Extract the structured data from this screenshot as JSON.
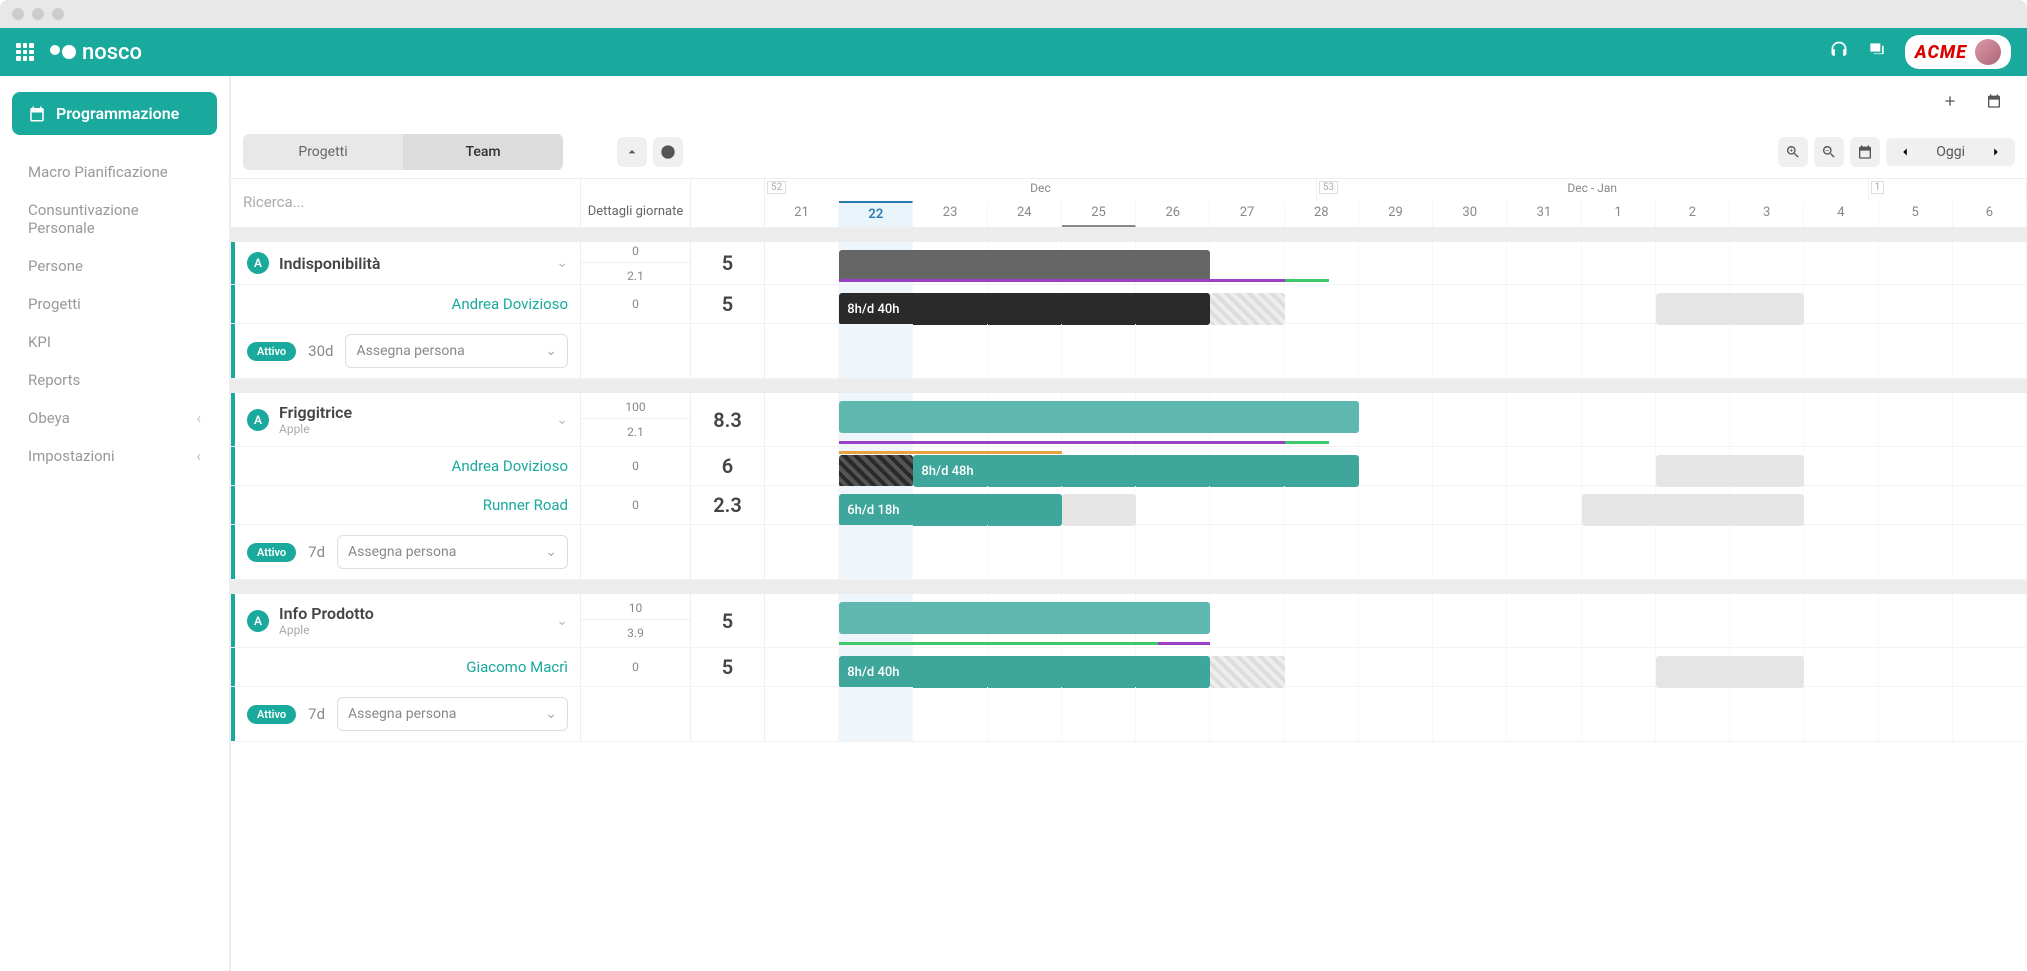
{
  "brand": {
    "app_name": "nosco",
    "company": "ACME"
  },
  "sidebar": {
    "active": {
      "label": "Programmazione"
    },
    "items": [
      {
        "label": "Macro Pianificazione",
        "expandable": false
      },
      {
        "label": "Consuntivazione Personale",
        "expandable": false
      },
      {
        "label": "Persone",
        "expandable": false
      },
      {
        "label": "Progetti",
        "expandable": false
      },
      {
        "label": "KPI",
        "expandable": false
      },
      {
        "label": "Reports",
        "expandable": false
      },
      {
        "label": "Obeya",
        "expandable": true
      },
      {
        "label": "Impostazioni",
        "expandable": true
      }
    ]
  },
  "toolbar": {
    "seg_projects": "Progetti",
    "seg_team": "Team",
    "today_label": "Oggi"
  },
  "search": {
    "placeholder": "Ricerca..."
  },
  "headers": {
    "details": "Dettagli giornate"
  },
  "calendar": {
    "months": [
      {
        "label": "Dec",
        "span": 7,
        "week": "52"
      },
      {
        "label": "Dec - Jan",
        "span": 7,
        "week": "53"
      },
      {
        "label": "",
        "span": 2,
        "week": "1"
      }
    ],
    "days": [
      "21",
      "22",
      "23",
      "24",
      "25",
      "26",
      "27",
      "28",
      "29",
      "30",
      "31",
      "1",
      "2",
      "3",
      "4",
      "5",
      "6"
    ],
    "today_index": 1,
    "holiday_index": 4,
    "weekend_idx": [
      5,
      6,
      12,
      13
    ]
  },
  "projects": [
    {
      "title": "Indisponibilità",
      "subtitle": "",
      "det": [
        "0",
        "2.1"
      ],
      "sum": "5",
      "accent": "#666",
      "bar": {
        "start": 1,
        "span": 5,
        "class": "gray",
        "label": ""
      },
      "underlines": [
        {
          "start": 1,
          "span": 6,
          "color": "purple"
        },
        {
          "start": 7,
          "span": 0.6,
          "color": "green"
        }
      ],
      "people": [
        {
          "name": "Andrea Dovizioso",
          "det": "0",
          "sum": "5",
          "bar": {
            "start": 1,
            "span": 5,
            "class": "dark",
            "label": "8h/d 40h"
          },
          "ghosts": [
            {
              "start": 6,
              "span": 1,
              "hatch": true
            },
            {
              "start": 12,
              "span": 2,
              "hatch": false
            }
          ]
        }
      ],
      "status": "Attivo",
      "duration": "30d",
      "assign": "Assegna persona"
    },
    {
      "title": "Friggitrice",
      "subtitle": "Apple",
      "det": [
        "100",
        "2.1"
      ],
      "sum": "8.3",
      "bar": {
        "start": 1,
        "span": 7,
        "class": "teal",
        "label": ""
      },
      "underlines": [
        {
          "start": 1,
          "span": 6,
          "color": "purple"
        },
        {
          "start": 7,
          "span": 0.6,
          "color": "green"
        }
      ],
      "people": [
        {
          "name": "Andrea Dovizioso",
          "det": "0",
          "sum": "6",
          "prebar": {
            "start": 1,
            "span": 1,
            "class": "hatch"
          },
          "bar": {
            "start": 2,
            "span": 6,
            "class": "tealdk",
            "label": "8h/d 48h"
          },
          "ghosts": [
            {
              "start": 12,
              "span": 2,
              "hatch": false
            }
          ],
          "underlines": [
            {
              "start": 1,
              "span": 3,
              "color": "orange"
            }
          ]
        },
        {
          "name": "Runner Road",
          "det": "0",
          "sum": "2.3",
          "bar": {
            "start": 1,
            "span": 3,
            "class": "tealdk",
            "label": "6h/d 18h"
          },
          "ghosts": [
            {
              "start": 4,
              "span": 1,
              "hatch": false
            },
            {
              "start": 11,
              "span": 3,
              "hatch": false
            }
          ]
        }
      ],
      "status": "Attivo",
      "duration": "7d",
      "assign": "Assegna persona"
    },
    {
      "title": "Info Prodotto",
      "subtitle": "Apple",
      "det": [
        "10",
        "3.9"
      ],
      "sum": "5",
      "bar": {
        "start": 1,
        "span": 5,
        "class": "teal",
        "label": ""
      },
      "underlines": [
        {
          "start": 1,
          "span": 4.3,
          "color": "green"
        },
        {
          "start": 5.3,
          "span": 0.7,
          "color": "purple"
        }
      ],
      "people": [
        {
          "name": "Giacomo Macrì",
          "det": "0",
          "sum": "5",
          "bar": {
            "start": 1,
            "span": 5,
            "class": "tealdk",
            "label": "8h/d 40h"
          },
          "ghosts": [
            {
              "start": 6,
              "span": 1,
              "hatch": true
            },
            {
              "start": 12,
              "span": 2,
              "hatch": false
            }
          ]
        }
      ],
      "status": "Attivo",
      "duration": "7d",
      "assign": "Assegna persona"
    }
  ]
}
